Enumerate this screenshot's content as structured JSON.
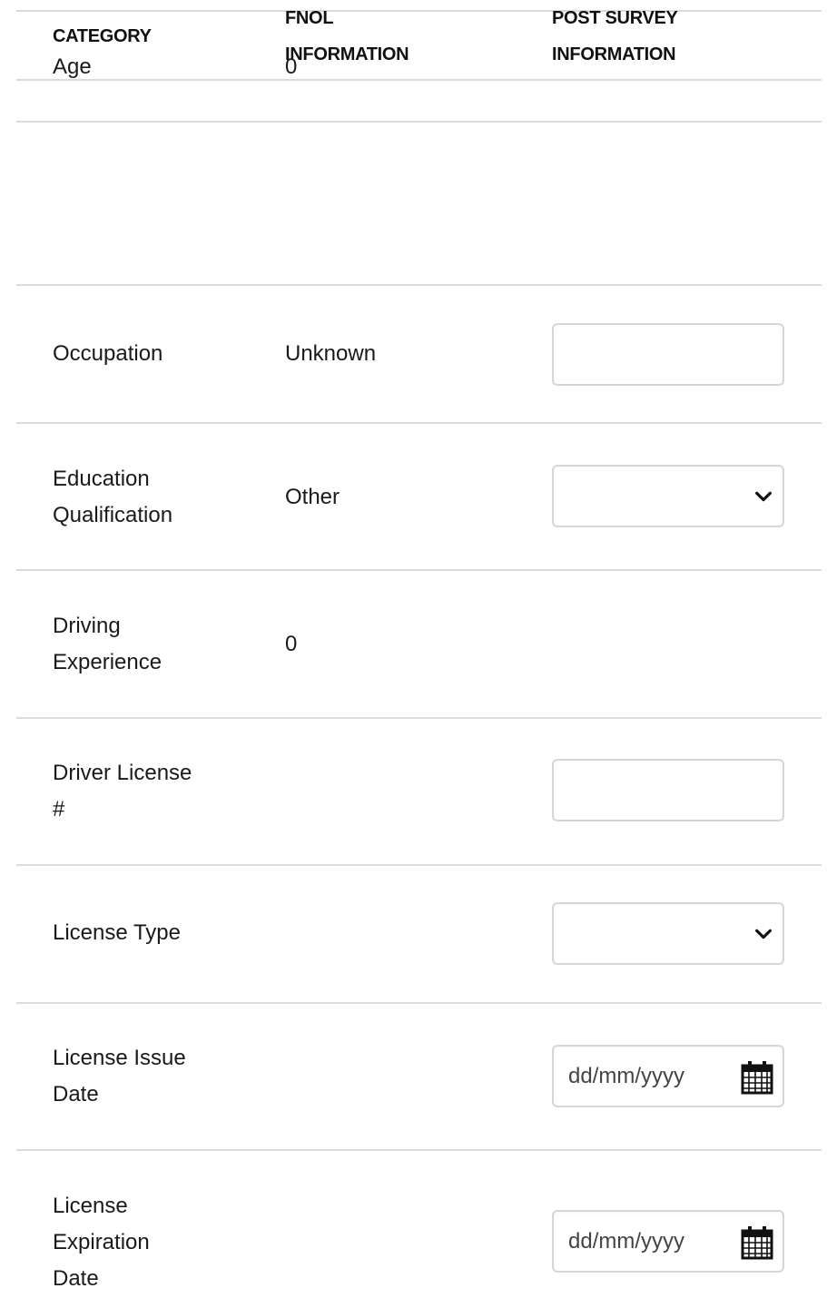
{
  "header": {
    "category": "CATEGORY",
    "fnol_line1": "FNOL",
    "fnol_line2": "INFORMATION",
    "post_line1": "POST SURVEY",
    "post_line2": "INFORMATION"
  },
  "rows": {
    "age": {
      "label": "Age",
      "fnol": "0"
    },
    "occupation": {
      "label": "Occupation",
      "fnol": "Unknown",
      "post_value": ""
    },
    "education": {
      "label_line1": "Education",
      "label_line2": "Qualification",
      "fnol": "Other",
      "post_value": ""
    },
    "driving_experience": {
      "label_line1": "Driving",
      "label_line2": "Experience",
      "fnol": "0"
    },
    "driver_license": {
      "label_line1": "Driver License",
      "label_line2": "#",
      "post_value": ""
    },
    "license_type": {
      "label": "License Type",
      "post_value": ""
    },
    "license_issue_date": {
      "label_line1": "License Issue",
      "label_line2": "Date",
      "placeholder": "dd/mm/yyyy"
    },
    "license_expiration_date": {
      "label_line1": "License",
      "label_line2": "Expiration",
      "label_line3": "Date",
      "placeholder": "dd/mm/yyyy"
    }
  },
  "icons": {
    "select": "chevron-down-icon",
    "date": "calendar-icon"
  }
}
